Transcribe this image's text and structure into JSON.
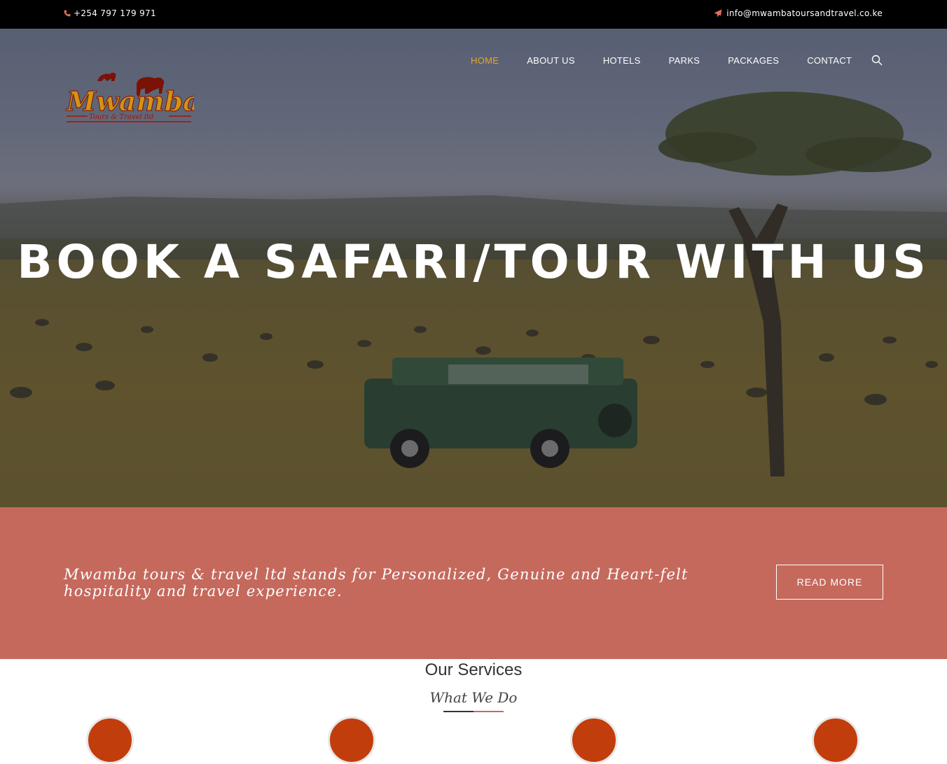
{
  "topbar": {
    "phone_icon": "phone-icon",
    "phone": "+254 797 179 971",
    "email_icon": "paper-plane-icon",
    "email": "info@mwambatoursandtravel.co.ke"
  },
  "brand": {
    "logo_text": "Mwamba",
    "logo_subtext": "Tours & Travel ltd"
  },
  "nav": {
    "items": [
      {
        "label": "HOME",
        "active": true
      },
      {
        "label": "ABOUT US",
        "active": false
      },
      {
        "label": "HOTELS",
        "active": false
      },
      {
        "label": "PARKS",
        "active": false
      },
      {
        "label": "PACKAGES",
        "active": false
      },
      {
        "label": "CONTACT",
        "active": false
      }
    ],
    "search_icon": "search-icon"
  },
  "hero": {
    "title": "BOOK A SAFARI/TOUR WITH US"
  },
  "band": {
    "tagline": "Mwamba tours & travel ltd stands for Personalized, Genuine and Heart-felt hospitality and travel experience.",
    "button": "READ MORE"
  },
  "services": {
    "title": "Our Services",
    "subtitle": "What We Do"
  },
  "colors": {
    "topbar_bg": "#000000",
    "accent_orange": "#e9a52c",
    "band_bg": "#c5695c",
    "service_icon_bg": "#c23d0c",
    "divider_left": "#333333",
    "divider_right": "#c5695c"
  }
}
